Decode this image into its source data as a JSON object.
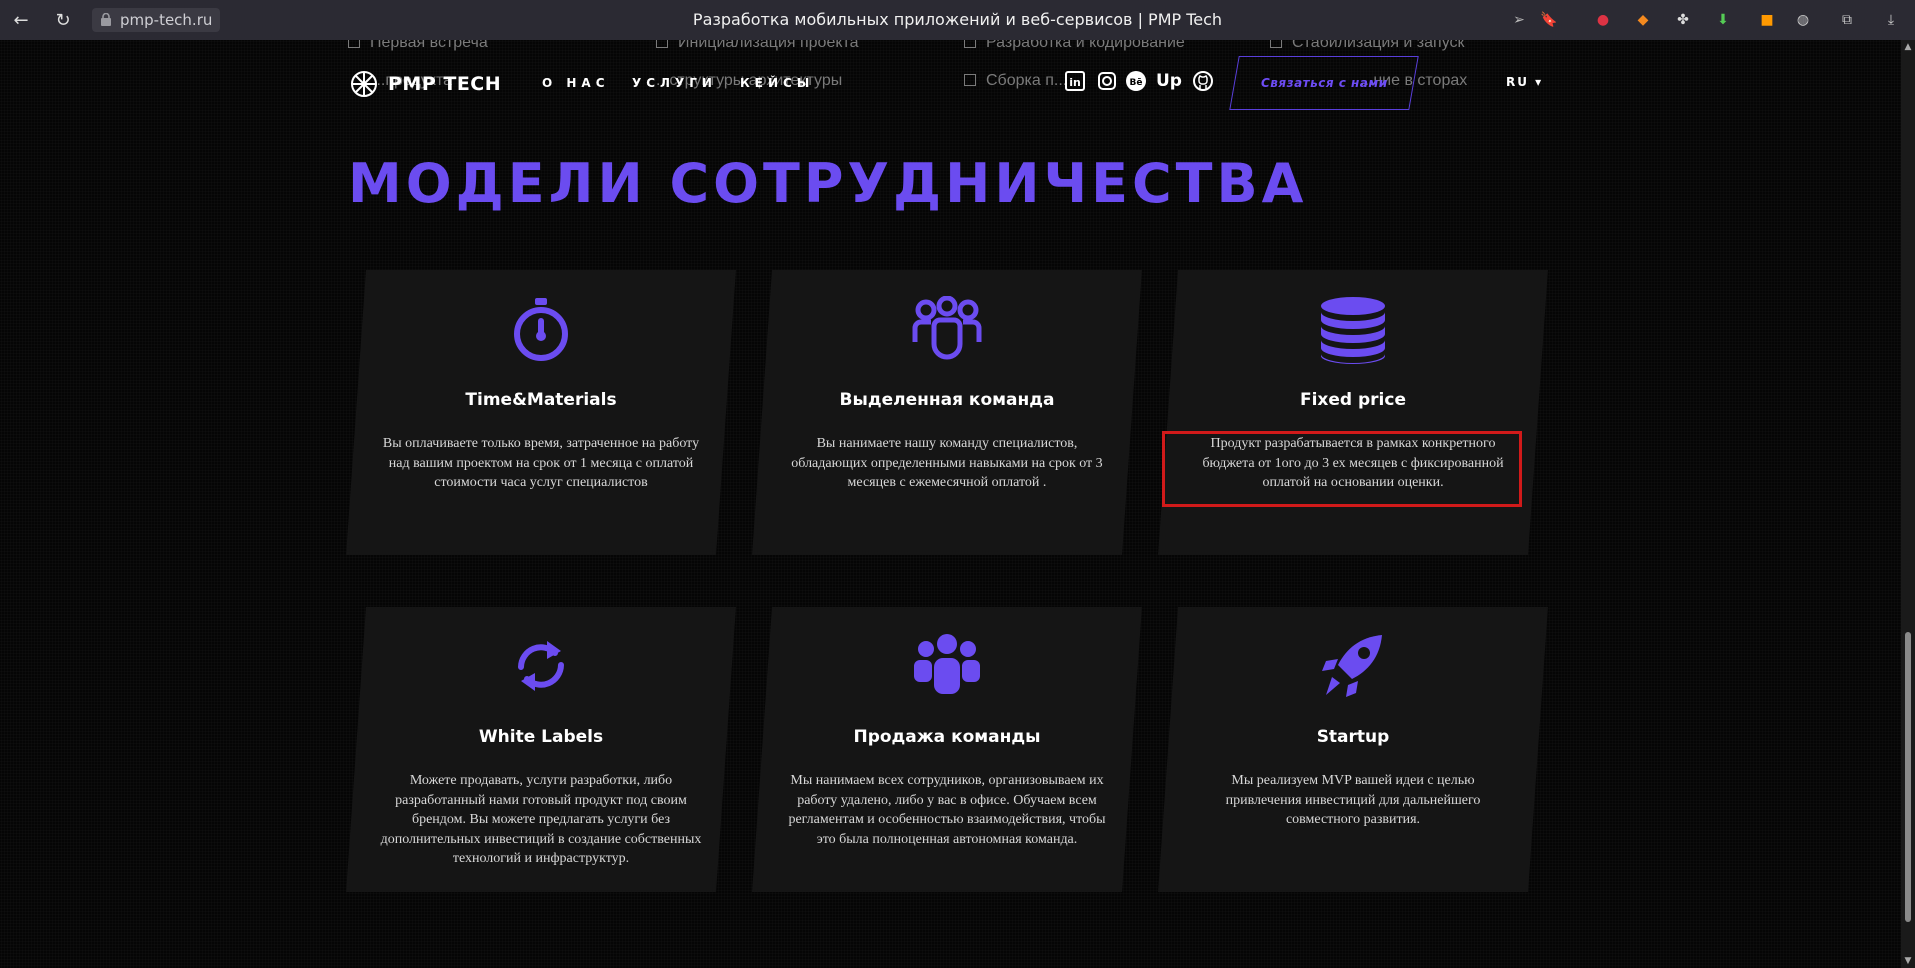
{
  "browser": {
    "url": "pmp-tech.ru",
    "tab_title": "Разработка мобильных приложений и веб-сервисов | PMP Tech"
  },
  "steps_row_1": [
    "Первая встреча",
    "Инициализация проекта",
    "Разработка и кодирование",
    "Стабилизация и запуск"
  ],
  "steps_row_2": [
    "...продукта",
    "...структуры архитектуры",
    "Сборка п...",
    "...ние в сторах"
  ],
  "header": {
    "logo_text": "PMP TECH",
    "menu": [
      "О НАС",
      "УСЛУГИ",
      "КЕЙСЫ"
    ],
    "contact_label": "Связаться с нами",
    "lang": "RU ▾"
  },
  "section_title": "МОДЕЛИ СОТРУДНИЧЕСТВА",
  "cards": [
    {
      "title": "Time&Materials",
      "desc": "Вы оплачиваете только время, затраченное на работу над вашим проектом на срок от 1 месяца с оплатой стоимости часа услуг специалистов",
      "icon": "stopwatch-icon"
    },
    {
      "title": "Выделенная команда",
      "desc": "Вы нанимаете нашу команду специалистов, обладающих определенными навыками на срок от 3 месяцев с ежемесячной оплатой .",
      "icon": "team-outline-icon"
    },
    {
      "title": "Fixed price",
      "desc": "Продукт разрабатывается в рамках конкретного бюджета от 1ого до 3 ех месяцев с фиксированной оплатой на основании оценки.",
      "icon": "coins-icon"
    },
    {
      "title": "White Labels",
      "desc": "Можете продавать, услуги разработки, либо разработанный нами готовый продукт под своим брендом. Вы можете предлагать услуги без дополнительных инвестиций в создание собственных технологий и инфраструктур.",
      "icon": "sync-icon"
    },
    {
      "title": "Продажа команды",
      "desc": "Мы нанимаем всех сотрудников, организовываем их работу удалено, либо у вас в офисе. Обучаем всем регламентам и особенностью взаимодействия, чтобы это была полноценная автономная команда.",
      "icon": "team-solid-icon"
    },
    {
      "title": "Startup",
      "desc": "Мы реализуем MVP вашей идеи с целью привлечения инвестиций для дальнейшего совместного развития.",
      "icon": "rocket-icon"
    }
  ],
  "colors": {
    "accent": "#6b4cf0",
    "highlight": "#d11a1a",
    "card_bg": "#151515"
  }
}
